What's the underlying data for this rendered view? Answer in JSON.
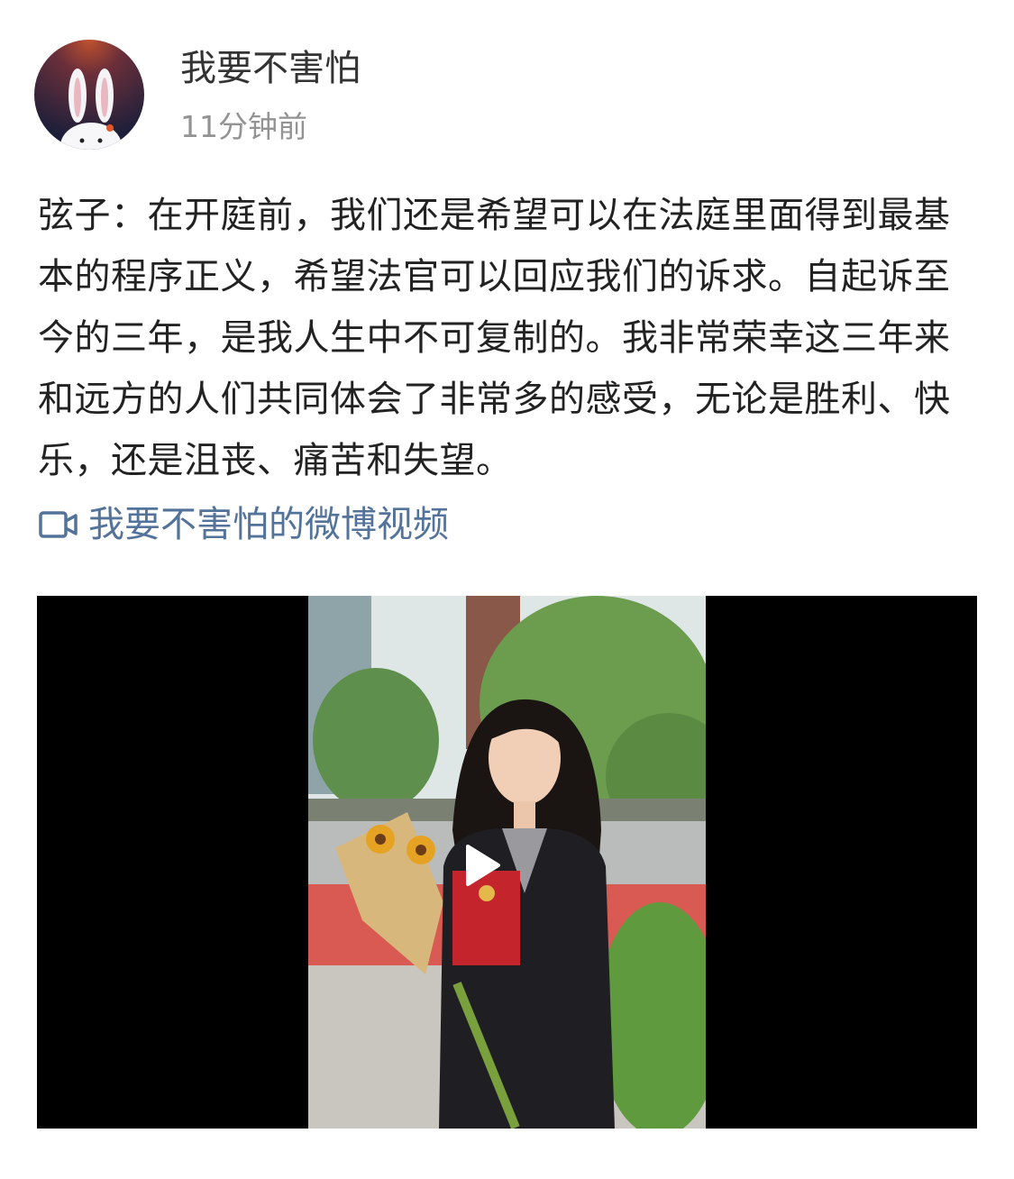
{
  "header": {
    "username": "我要不害怕",
    "timestamp": "11分钟前",
    "avatar_icon": "rabbit-avatar-icon"
  },
  "post": {
    "text": "弦子：在开庭前，我们还是希望可以在法庭里面得到最基本的程序正义，希望法官可以回应我们的诉求。自起诉至今的三年，是我人生中不可复制的。我非常荣幸这三年来和远方的人们共同体会了非常多的感受，无论是胜利、快乐，还是沮丧、痛苦和失望。",
    "video_link_icon": "video-camera-icon",
    "video_link_label": "我要不害怕的微博视频"
  },
  "video": {
    "play_icon": "play-icon"
  },
  "colors": {
    "link": "#53739b",
    "timestamp": "#939393",
    "text": "#222222"
  }
}
